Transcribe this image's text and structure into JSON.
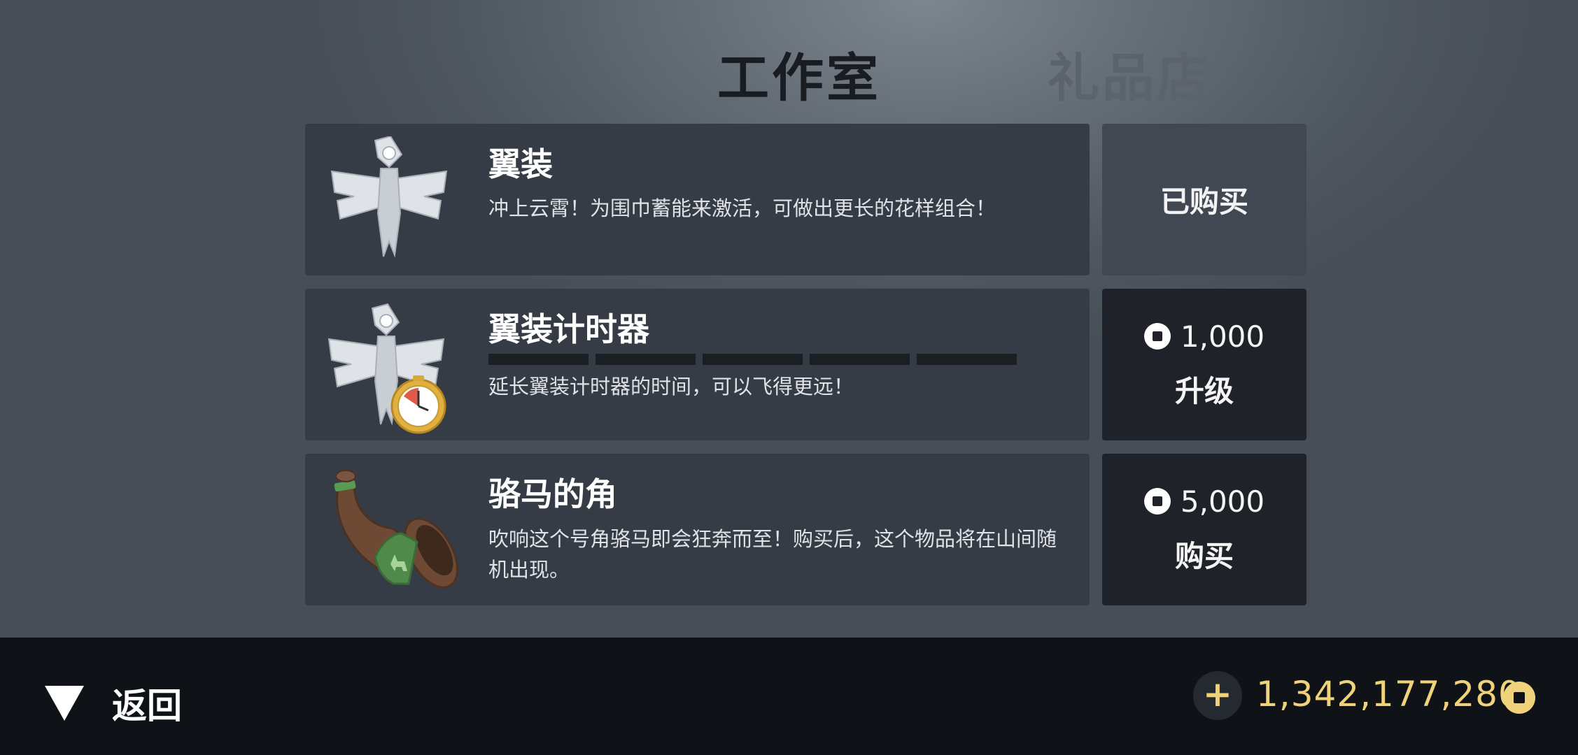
{
  "tabs": [
    {
      "label": "工作室",
      "active": true
    },
    {
      "label": "礼品店",
      "active": false
    }
  ],
  "items": [
    {
      "title": "翼装",
      "description": "冲上云霄！为围巾蓄能来激活，可做出更长的花样组合！",
      "icon": "wingsuit-icon",
      "status_label": "已购买"
    },
    {
      "title": "翼装计时器",
      "description": "延长翼装计时器的时间，可以飞得更远！",
      "icon": "wingsuit-timer-icon",
      "upgrade_levels_total": 5,
      "upgrade_levels_filled": 0,
      "cost": "1,000",
      "action_label": "升级"
    },
    {
      "title": "骆马的角",
      "description": "吹响这个号角骆马即会狂奔而至！购买后，这个物品将在山间随机出现。",
      "icon": "llama-horn-icon",
      "cost": "5,000",
      "action_label": "购买"
    }
  ],
  "footer": {
    "back_label": "返回",
    "add_coins_symbol": "+",
    "balance": "1,342,177,280"
  },
  "colors": {
    "accent_gold": "#efd27a",
    "card_bg": "#363c45",
    "price_bg": "#1f2329",
    "footer_bg": "#0f1216"
  }
}
